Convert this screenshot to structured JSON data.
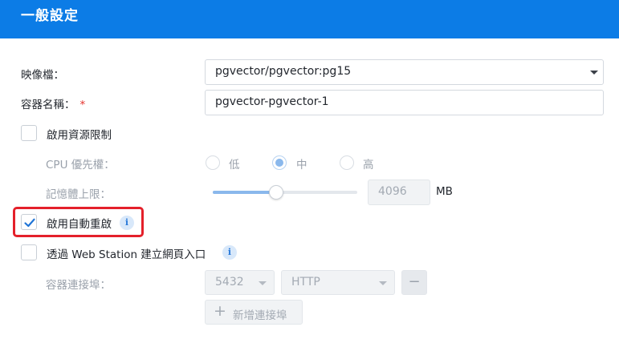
{
  "header": {
    "title": "一般設定"
  },
  "image": {
    "label": "映像檔：",
    "value": "pgvector/pgvector:pg15"
  },
  "container_name": {
    "label": "容器名稱：",
    "required_mark": "*",
    "value": "pgvector-pgvector-1"
  },
  "resource_limit": {
    "label": "啟用資源限制",
    "checked": false
  },
  "cpu_priority": {
    "label": "CPU 優先權：",
    "options": [
      "低",
      "中",
      "高"
    ],
    "selected": "中"
  },
  "memory_limit": {
    "label": "記憶體上限：",
    "value": "4096",
    "unit": "MB",
    "slider_fraction": 0.44
  },
  "auto_restart": {
    "label": "啟用自動重啟",
    "checked": true,
    "info_icon": "i"
  },
  "web_station": {
    "label": "透過 Web Station 建立網頁入口",
    "checked": false,
    "info_icon": "i"
  },
  "port": {
    "label": "容器連接埠：",
    "port_value": "5432",
    "protocol_value": "HTTP",
    "remove_symbol": "−",
    "add_label": "新增連接埠",
    "add_symbol": "+"
  },
  "colors": {
    "accent": "#0c7ce6",
    "highlight": "#e4202a"
  }
}
